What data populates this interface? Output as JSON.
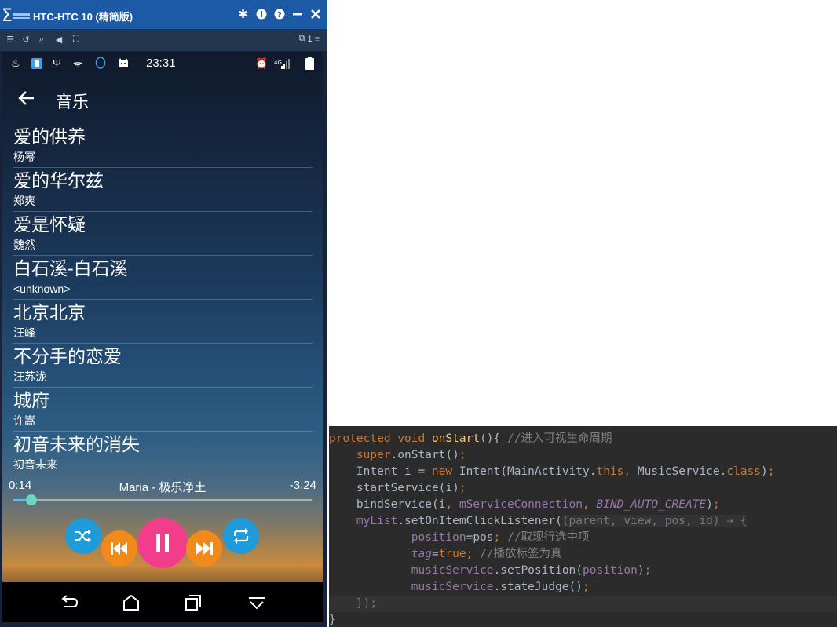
{
  "emulator": {
    "title": "HTC-HTC 10 (精简版)",
    "page_indicator": "1",
    "window_controls": [
      "settings-icon",
      "info-icon",
      "help-icon",
      "minimize-icon",
      "close-icon"
    ]
  },
  "phone": {
    "status": {
      "time": "23:31"
    },
    "app_title": "音乐",
    "songs": [
      {
        "title": "爱的供养",
        "artist": "杨幂"
      },
      {
        "title": "爱的华尔兹",
        "artist": "郑爽"
      },
      {
        "title": "爱是怀疑",
        "artist": "魏然"
      },
      {
        "title": "白石溪-白石溪",
        "artist": "<unknown>"
      },
      {
        "title": "北京北京",
        "artist": "汪峰"
      },
      {
        "title": "不分手的恋爱",
        "artist": "汪苏泷"
      },
      {
        "title": "城府",
        "artist": "许嵩"
      },
      {
        "title": "初音未来的消失",
        "artist": "初音未来"
      }
    ],
    "player": {
      "elapsed": "0:14",
      "remaining": "-3:24",
      "now_playing": "Maria - 极乐净土",
      "progress_fraction": 0.06
    },
    "colors": {
      "shuffle": "#1e9bd8",
      "prev_next": "#f08a1c",
      "play": "#f23d8a"
    }
  },
  "code": {
    "lines": [
      "protected void onStart(){ //进入可视生命周期",
      "    super.onStart();",
      "    Intent i = new Intent(MainActivity.this, MusicService.class);",
      "    startService(i);",
      "    bindService(i, mServiceConnection, BIND_AUTO_CREATE);",
      "    myList.setOnItemClickListener((parent, view, pos, id) → {",
      "            position=pos; //取现行选中项",
      "            tag=true; //播放标签为真",
      "            musicService.setPosition(position);",
      "            musicService.stateJudge();",
      "    });",
      "}"
    ]
  }
}
